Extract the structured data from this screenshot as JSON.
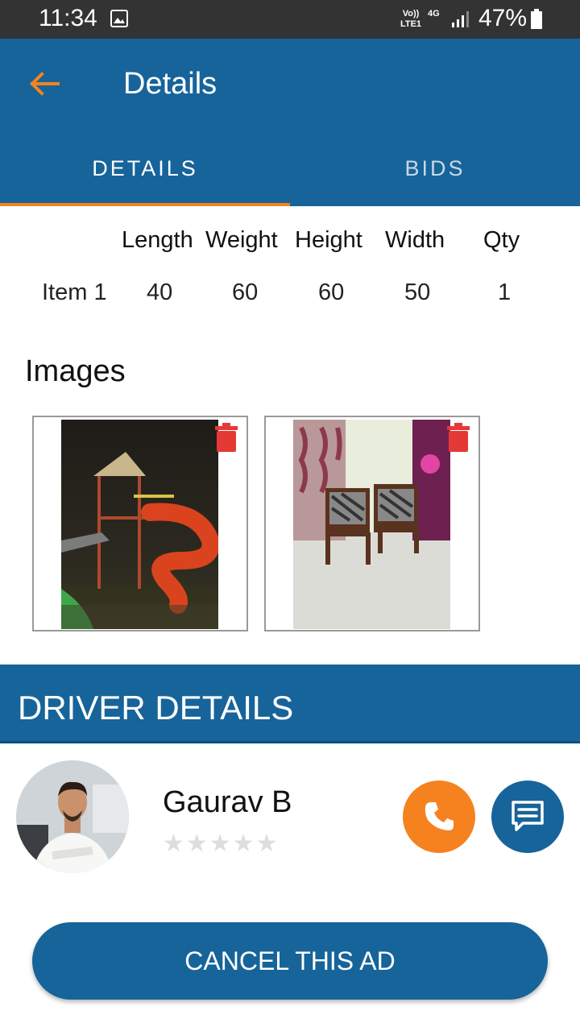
{
  "status_bar": {
    "time": "11:34",
    "lte_label": "Vo)) LTE1",
    "network_label": "4G",
    "battery": "47%"
  },
  "app_bar": {
    "title": "Details",
    "back_icon": "arrow-left-icon"
  },
  "tabs": [
    {
      "label": "DETAILS",
      "active": true
    },
    {
      "label": "BIDS",
      "active": false
    }
  ],
  "items_table": {
    "headers": [
      "Length",
      "Weight",
      "Height",
      "Width",
      "Qty"
    ],
    "rows": [
      {
        "name": "Item 1",
        "values": [
          "40",
          "60",
          "60",
          "50",
          "1"
        ]
      }
    ]
  },
  "images_section": {
    "title": "Images",
    "images": [
      {
        "subject": "playground slide at night",
        "delete_icon": "trash-icon"
      },
      {
        "subject": "wooden sofa chairs in room",
        "delete_icon": "trash-icon"
      }
    ]
  },
  "driver_section": {
    "title": "DRIVER DETAILS",
    "name": "Gaurav B",
    "rating_stars": "★★★★★",
    "rating": 0,
    "call_icon": "phone-icon",
    "chat_icon": "chat-icon"
  },
  "cancel_button": {
    "label": "CANCEL THIS AD"
  },
  "colors": {
    "primary": "#16649a",
    "accent": "#f5821f",
    "delete": "#e53935",
    "status_bar": "#333333"
  }
}
